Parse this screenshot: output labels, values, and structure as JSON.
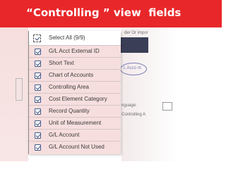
{
  "slide": {
    "title": "“Controlling ” view  fields"
  },
  "background": {
    "snippet_top": "der Or impor",
    "snippet_account": "L Acco nt:",
    "snippet_language": "nguage:",
    "snippet_ca": "Controlling A"
  },
  "field_list": {
    "select_all_label": "Select All (9/9)",
    "items": [
      {
        "label": "G/L Acct External ID",
        "checked": true
      },
      {
        "label": "Short Text",
        "checked": true
      },
      {
        "label": "Chart of Accounts",
        "checked": true
      },
      {
        "label": "Controlling Area",
        "checked": true
      },
      {
        "label": "Cost Element Category",
        "checked": true
      },
      {
        "label": "Record Quantity",
        "checked": true
      },
      {
        "label": "Unit of Measurement",
        "checked": true
      },
      {
        "label": "G/L Account",
        "checked": true
      },
      {
        "label": "G/L Account Not Used",
        "checked": true
      }
    ]
  },
  "colors": {
    "title_bar": "#e8272a",
    "selected_row": "#f7dede",
    "checkbox_border": "#3f5b8c"
  }
}
